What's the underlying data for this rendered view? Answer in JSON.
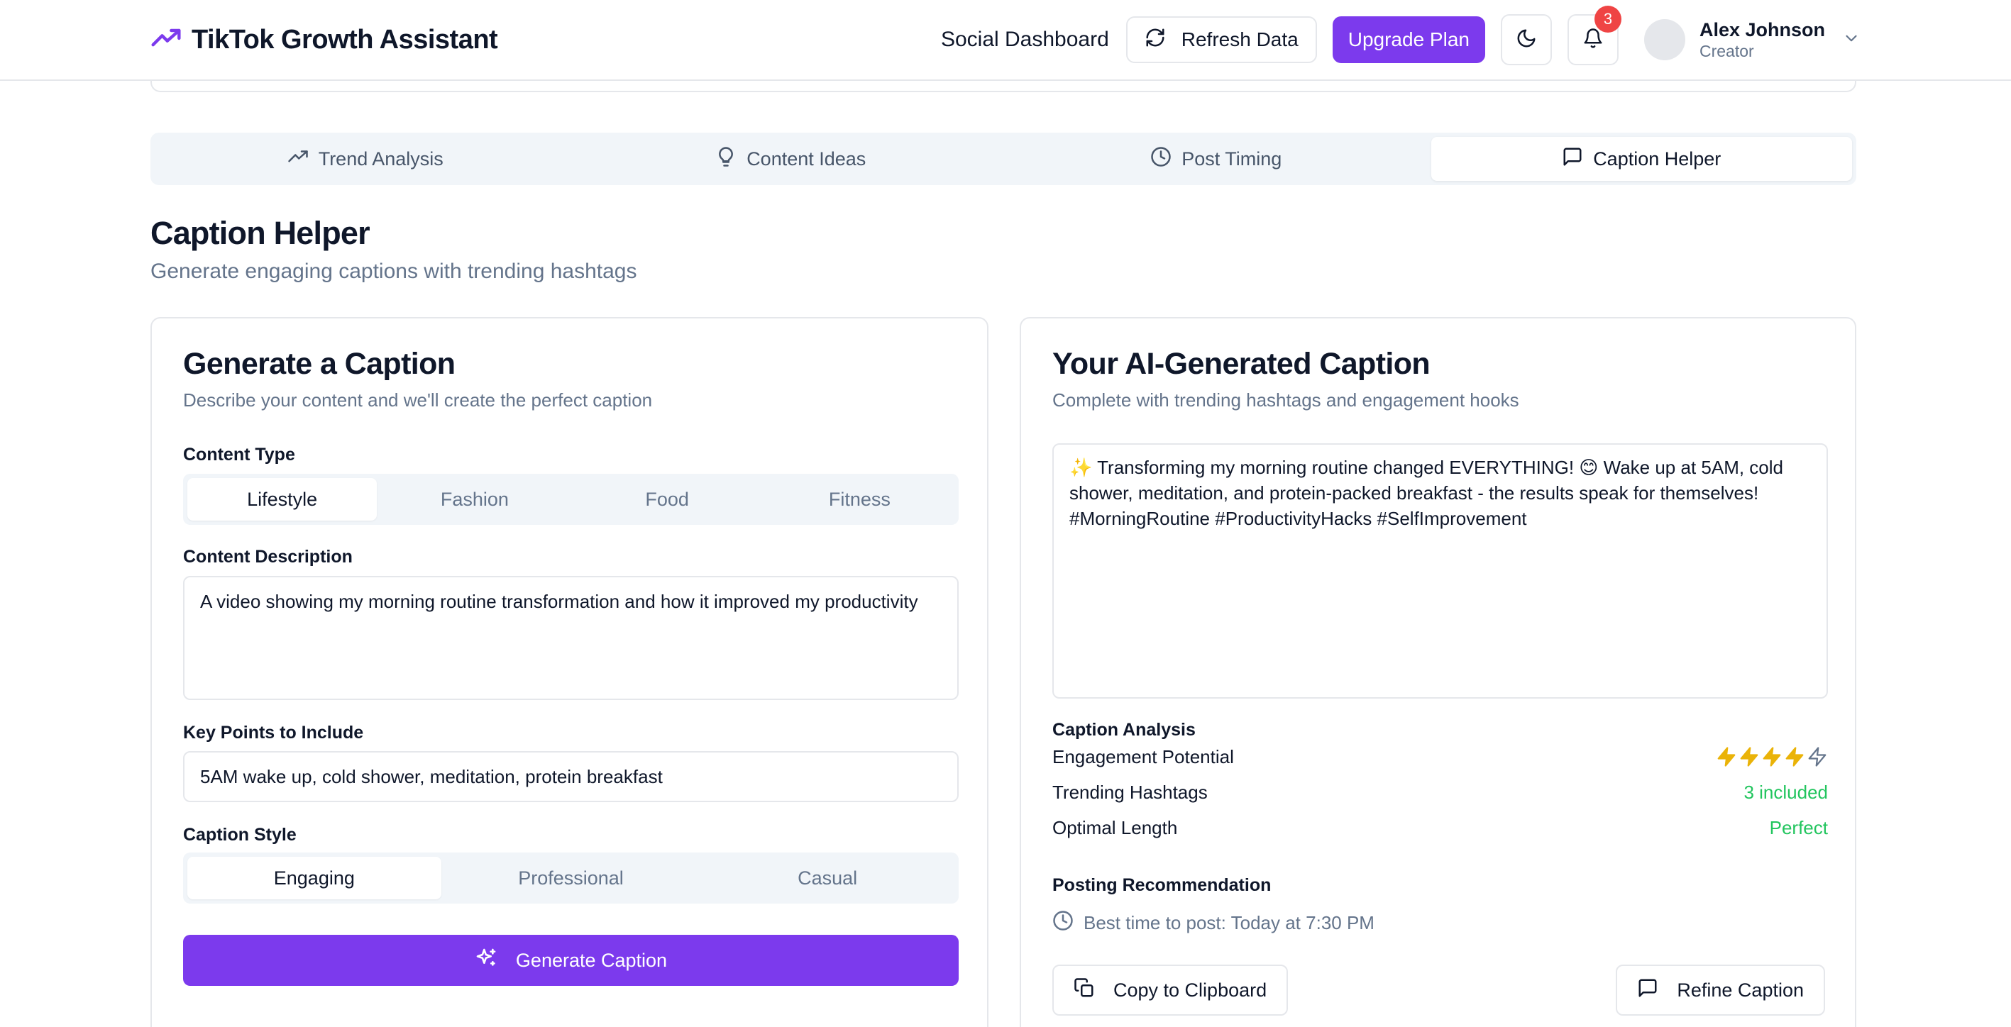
{
  "header": {
    "app_title": "TikTok Growth Assistant",
    "nav_link": "Social Dashboard",
    "refresh_label": "Refresh Data",
    "upgrade_label": "Upgrade Plan",
    "notification_count": "3",
    "user": {
      "name": "Alex Johnson",
      "role": "Creator"
    }
  },
  "tabs": [
    {
      "label": "Trend Analysis",
      "icon": "trending-up-icon"
    },
    {
      "label": "Content Ideas",
      "icon": "lightbulb-icon"
    },
    {
      "label": "Post Timing",
      "icon": "clock-icon"
    },
    {
      "label": "Caption Helper",
      "icon": "message-square-icon",
      "active": true
    }
  ],
  "section": {
    "title": "Caption Helper",
    "subtitle": "Generate engaging captions with trending hashtags"
  },
  "generate_card": {
    "title": "Generate a Caption",
    "subtitle": "Describe your content and we'll create the perfect caption",
    "content_type_label": "Content Type",
    "content_types": [
      "Lifestyle",
      "Fashion",
      "Food",
      "Fitness"
    ],
    "content_type_selected": "Lifestyle",
    "description_label": "Content Description",
    "description_value": "A video showing my morning routine transformation and how it improved my productivity",
    "key_points_label": "Key Points to Include",
    "key_points_value": "5AM wake up, cold shower, meditation, protein breakfast",
    "style_label": "Caption Style",
    "styles": [
      "Engaging",
      "Professional",
      "Casual"
    ],
    "style_selected": "Engaging",
    "generate_button": "Generate Caption"
  },
  "result_card": {
    "title": "Your AI-Generated Caption",
    "subtitle": "Complete with trending hashtags and engagement hooks",
    "caption_text": "✨ Transforming my morning routine changed EVERYTHING! 😊 Wake up at 5AM, cold shower, meditation, and protein-packed breakfast - the results speak for themselves! #MorningRoutine #ProductivityHacks #SelfImprovement",
    "analysis_label": "Caption Analysis",
    "engagement_label": "Engagement Potential",
    "engagement_rating": 4,
    "engagement_max": 5,
    "hashtags_label": "Trending Hashtags",
    "hashtags_value": "3 included",
    "length_label": "Optimal Length",
    "length_value": "Perfect",
    "posting_label": "Posting Recommendation",
    "posting_value": "Best time to post: Today at 7:30 PM",
    "copy_button": "Copy to Clipboard",
    "refine_button": "Refine Caption"
  },
  "colors": {
    "accent": "#7c3aed",
    "success": "#22c55e",
    "star_filled": "#eab308",
    "badge": "#ef4444"
  }
}
